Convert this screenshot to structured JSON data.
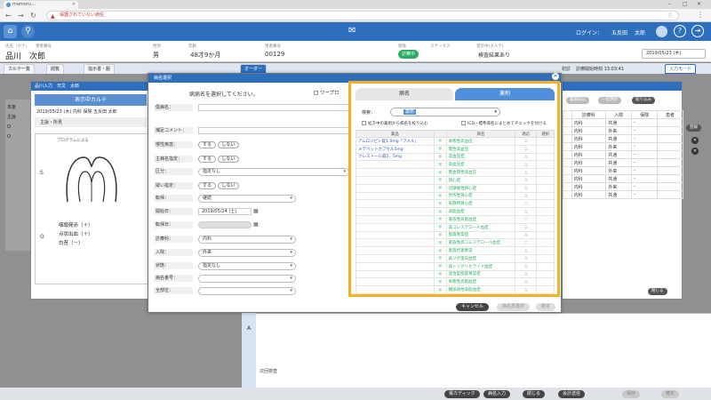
{
  "browser": {
    "tab_title": "mamoru...",
    "url_warning": "保護されていない通信",
    "url_rest": " "
  },
  "header": {
    "login_label": "ログイン：",
    "login_user": "五反田",
    "login_name": "太郎"
  },
  "patient": {
    "small_labels": [
      "氏名（カナ）",
      "患者番号",
      "性別",
      "年齢",
      "患者番号",
      "保険",
      "ステータス",
      "受診中(カルテ)"
    ],
    "name": "品川　次郎",
    "sex": "男",
    "age": "48才9か月",
    "number": "00129",
    "badge": "診察中",
    "status": "検査結果あり",
    "date": "2019/05/23 (木)"
  },
  "karte_tabs": [
    "カルテ一覧",
    "閲覧",
    "指示書・服",
    "オーダー"
  ],
  "right_head": {
    "label": "初診",
    "last_visit": "診療開始時刻 13:03:41",
    "input_mode": "入力モード"
  },
  "karte_window": {
    "title": "品川入力　日文　太郎",
    "heading": "表示中カルテ",
    "sub": "2019/05/23 (木) 内科 保険 五反田 太郎",
    "section": "主訴・所見",
    "s": "S",
    "o": "O",
    "diagram_caption": "プログラムによる",
    "notes": [
      "咽頭発赤（＋）",
      "点状出血（＋）",
      "白苔（－）"
    ]
  },
  "left_stub": [
    "本家",
    "主訴",
    "O",
    "O"
  ],
  "dialog": {
    "title": "病名選択",
    "hint": "病病名を選択してください。",
    "wordpro": "ワープロ",
    "rows": [
      {
        "label": "傷病名：",
        "value": ""
      },
      {
        "label": "補足コメント：",
        "value": ""
      },
      {
        "label": "慢性疾患：",
        "toggles": [
          "する",
          "しない"
        ]
      },
      {
        "label": "主病名指定：",
        "toggles": [
          "する",
          "しない"
        ]
      },
      {
        "label": "区分：",
        "select": "指定なし"
      },
      {
        "label": "疑い指定：",
        "toggles": [
          "する",
          "しない"
        ]
      },
      {
        "label": "転帰：",
        "select": "継続"
      },
      {
        "label": "開始日：",
        "date": "2019/05/24 (土)"
      },
      {
        "label": "転帰日：",
        "date": ""
      },
      {
        "label": "診療科：",
        "select": "内科"
      },
      {
        "label": "入院：",
        "select": "外来"
      },
      {
        "label": "状態：",
        "select": "指定なし"
      },
      {
        "label": "病名番号：",
        "select": ""
      },
      {
        "label": "全部位：",
        "select": ""
      }
    ],
    "footer": {
      "cancel": "キャンセル",
      "reselect": "病名再選択",
      "confirm": "確定"
    }
  },
  "select_panel": {
    "tab_name": "病名",
    "tab_drug": "薬剤",
    "filter_label": "検索：",
    "filter_value": "薬剤",
    "checkbox_1": "処方中の薬剤から病名を絞り込む",
    "checkbox_2": "ICD・標準病名にまとめてチェックを付ける",
    "columns": [
      "薬品",
      "",
      "病名",
      "適応",
      "選択"
    ],
    "rows": [
      {
        "drug": "アムロジピン錠1.0mg「アメル」",
        "code": "◎",
        "name": "本態性高血圧",
        "fit": "△",
        "sel": ""
      },
      {
        "drug": "メデペットカプセル5mg",
        "code": "◎",
        "name": "腎性高血圧",
        "fit": "△",
        "sel": ""
      },
      {
        "drug": "クレストール錠2．5mg",
        "code": "◎",
        "name": "高血圧症",
        "fit": "△",
        "sel": ""
      },
      {
        "drug": "",
        "code": "◎",
        "name": "高血圧症",
        "fit": "△",
        "sel": ""
      },
      {
        "drug": "",
        "code": "◎",
        "name": "腎血管性高血圧",
        "fit": "△",
        "sel": ""
      },
      {
        "drug": "",
        "code": "◎",
        "name": "狭心症",
        "fit": "△",
        "sel": ""
      },
      {
        "drug": "",
        "code": "◎",
        "name": "冠攣縮性狭心症",
        "fit": "△",
        "sel": ""
      },
      {
        "drug": "",
        "code": "◎",
        "name": "労作性狭心症",
        "fit": "△",
        "sel": ""
      },
      {
        "drug": "",
        "code": "◎",
        "name": "安静時狭心症",
        "fit": "○",
        "sel": ""
      },
      {
        "drug": "",
        "code": "◎",
        "name": "高脂血症",
        "fit": "△",
        "sel": ""
      },
      {
        "drug": "",
        "code": "◎",
        "name": "家族性高脂血症",
        "fit": "○",
        "sel": ""
      },
      {
        "drug": "",
        "code": "◎",
        "name": "高コレステロール血症",
        "fit": "△",
        "sel": ""
      },
      {
        "drug": "",
        "code": "◎",
        "name": "脂質異常症",
        "fit": "△",
        "sel": ""
      },
      {
        "drug": "",
        "code": "◎",
        "name": "家族性高コレステロール血症",
        "fit": "○",
        "sel": ""
      },
      {
        "drug": "",
        "code": "◎",
        "name": "脂質代謝異常",
        "fit": "△",
        "sel": ""
      },
      {
        "drug": "",
        "code": "◎",
        "name": "高リポ蛋白血症",
        "fit": "△",
        "sel": ""
      },
      {
        "drug": "",
        "code": "◎",
        "name": "高トリグリセライド血症",
        "fit": "△",
        "sel": ""
      },
      {
        "drug": "",
        "code": "◎",
        "name": "混合型脂質異常症",
        "fit": "△",
        "sel": ""
      },
      {
        "drug": "",
        "code": "◎",
        "name": "本態性高脂血症",
        "fit": "△",
        "sel": ""
      },
      {
        "drug": "",
        "code": "◎",
        "name": "糖尿病性高脂血症",
        "fit": "△",
        "sel": ""
      }
    ]
  },
  "bg_panel": {
    "buttons": [
      "履歴取込",
      "一括更新",
      "絞り込み"
    ],
    "columns": [
      "",
      "診療科",
      "入院",
      "保険",
      "患者"
    ],
    "rows": [
      {
        "a": "内科",
        "b": "共通",
        "c": "-"
      },
      {
        "a": "内科",
        "b": "外来",
        "c": "-"
      },
      {
        "a": "内科",
        "b": "共通",
        "c": "-"
      },
      {
        "a": "内科",
        "b": "外来",
        "c": "-"
      },
      {
        "a": "内科",
        "b": "共通",
        "c": "-"
      },
      {
        "a": "内科",
        "b": "共通",
        "c": "-"
      },
      {
        "a": "内科",
        "b": "外来",
        "c": "-"
      },
      {
        "a": "内科",
        "b": "共通",
        "c": "-"
      },
      {
        "a": "内科",
        "b": "外来",
        "c": "-"
      },
      {
        "a": "内科",
        "b": "共通",
        "c": "-"
      }
    ],
    "register": "登録",
    "close": "閉じる"
  },
  "lower": {
    "a_label": "A",
    "last_label": "次回検査"
  },
  "bottom_buttons": [
    {
      "label": "電カディック",
      "dark": true
    },
    {
      "label": "病名入力",
      "dark": true
    },
    {
      "label": "閉じる",
      "dark": true
    },
    {
      "label": "会計送信",
      "dark": true
    },
    {
      "label": "保存",
      "dark": false
    },
    {
      "label": "確定",
      "dark": false
    }
  ],
  "colors": {
    "header_blue": "#2e6fbd",
    "highlight_orange": "#f5b023",
    "active_tab_blue": "#4f8fdc",
    "green_text": "#27ae60"
  }
}
